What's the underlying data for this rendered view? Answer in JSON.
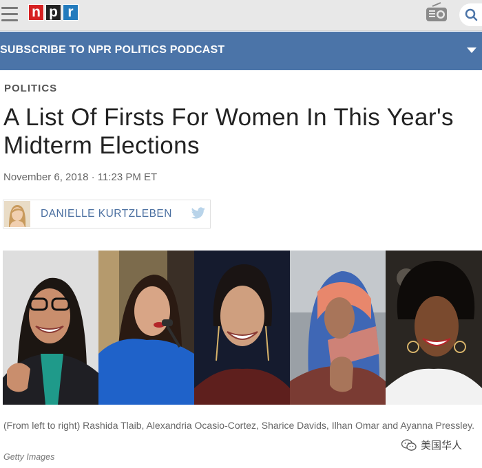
{
  "header": {
    "logo_letters": [
      "n",
      "p",
      "r"
    ],
    "logo_colors": [
      "#d62021",
      "#222222",
      "#237bbd"
    ],
    "menu_icon": "hamburger-menu-icon",
    "radio_icon": "radio-icon",
    "search_icon": "search-icon"
  },
  "subscribe": {
    "label": "SUBSCRIBE TO NPR POLITICS PODCAST",
    "icon": "chevron-down-icon",
    "color": "#4b74a8"
  },
  "article": {
    "section": "POLITICS",
    "title": "A List Of Firsts For Women In This Year's Midterm Elections",
    "date": "November 6, 2018 · 11:23 PM ET",
    "author": "DANIELLE KURTZLEBEN",
    "author_icon": "twitter-icon",
    "caption": "(From left to right) Rashida Tlaib, Alexandria Ocasio-Cortez, Sharice Davids, Ilhan Omar and Ayanna Pressley.",
    "credit": "Getty Images"
  },
  "watermark": {
    "text": "美国华人",
    "icon": "wechat-icon"
  }
}
